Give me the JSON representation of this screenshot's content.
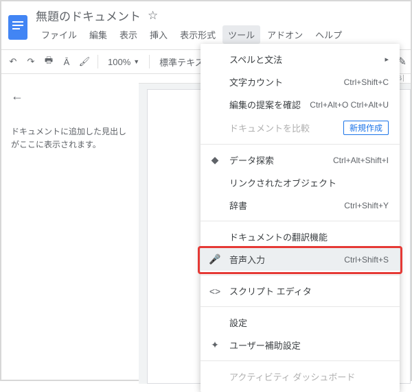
{
  "header": {
    "doc_title": "無題のドキュメント"
  },
  "menubar": {
    "items": [
      "ファイル",
      "編集",
      "表示",
      "挿入",
      "表示形式",
      "ツール",
      "アドオン",
      "ヘルプ"
    ],
    "active_index": 5
  },
  "toolbar": {
    "zoom": "100%",
    "style": "標準テキス…"
  },
  "outline": {
    "placeholder": "ドキュメントに追加した見出しがここに表示されます。"
  },
  "ruler": {
    "mark": "6"
  },
  "dropdown": {
    "items": [
      {
        "label": "スペルと文法",
        "icon": "",
        "shortcut": "",
        "sub": true
      },
      {
        "label": "文字カウント",
        "icon": "",
        "shortcut": "Ctrl+Shift+C"
      },
      {
        "label": "編集の提案を確認",
        "icon": "",
        "shortcut": "Ctrl+Alt+O Ctrl+Alt+U"
      },
      {
        "label": "ドキュメントを比較",
        "icon": "",
        "shortcut": "",
        "disabled": true,
        "badge": "新規作成"
      },
      {
        "divider": true
      },
      {
        "label": "データ探索",
        "icon": "◆",
        "shortcut": "Ctrl+Alt+Shift+I"
      },
      {
        "label": "リンクされたオブジェクト",
        "icon": "",
        "shortcut": ""
      },
      {
        "label": "辞書",
        "icon": "",
        "shortcut": "Ctrl+Shift+Y"
      },
      {
        "divider": true
      },
      {
        "label": "ドキュメントの翻訳機能",
        "icon": "",
        "shortcut": ""
      },
      {
        "label": "音声入力",
        "icon": "🎤",
        "shortcut": "Ctrl+Shift+S",
        "selected": true
      },
      {
        "divider": true
      },
      {
        "label": "スクリプト エディタ",
        "icon": "<>",
        "shortcut": ""
      },
      {
        "divider": true
      },
      {
        "label": "設定",
        "icon": "",
        "shortcut": ""
      },
      {
        "label": "ユーザー補助設定",
        "icon": "✦",
        "shortcut": ""
      },
      {
        "divider": true
      },
      {
        "label": "アクティビティ ダッシュボード",
        "icon": "",
        "shortcut": "",
        "disabled": true
      }
    ]
  }
}
